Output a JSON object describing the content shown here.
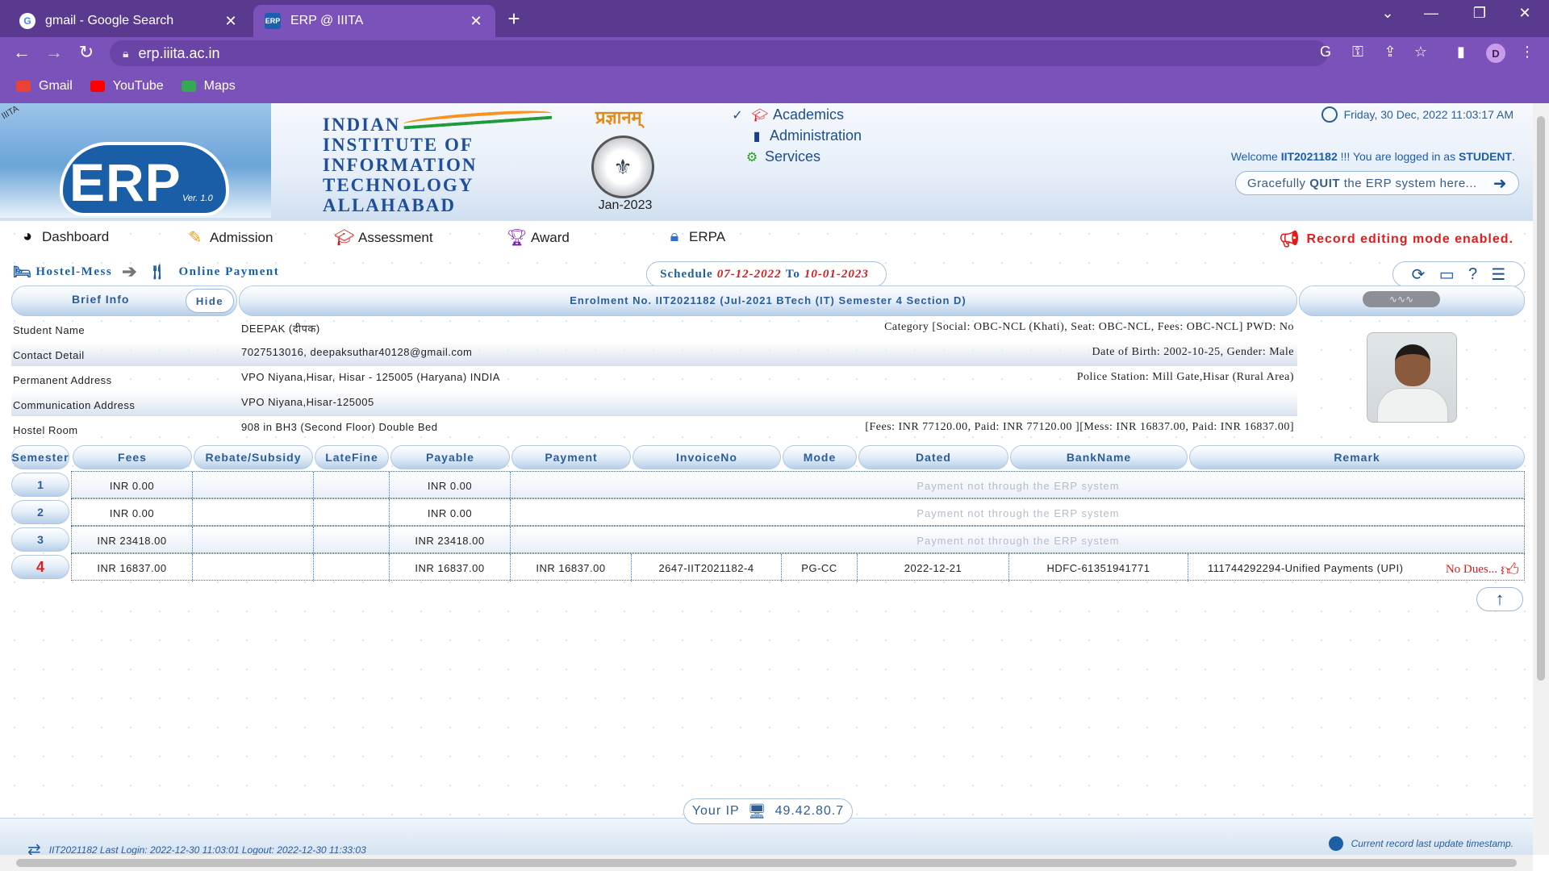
{
  "browser": {
    "tabs": [
      {
        "title": "gmail - Google Search",
        "favicon": "google-icon",
        "active": false
      },
      {
        "title": "ERP @ IIITA",
        "favicon": "erp-icon",
        "active": true
      }
    ],
    "url": "erp.iiita.ac.in",
    "bookmarks": [
      {
        "label": "Gmail",
        "icon": "gmail-icon",
        "color": "#ea4335"
      },
      {
        "label": "YouTube",
        "icon": "youtube-icon",
        "color": "#ff0000"
      },
      {
        "label": "Maps",
        "icon": "maps-icon",
        "color": "#34a853"
      }
    ],
    "profile_initial": "D"
  },
  "header": {
    "logo_text": "ERP",
    "logo_version": "Ver. 1.0",
    "corner_label": "IIITA",
    "institute_lines": [
      "INDIAN",
      "INSTITUTE OF",
      "INFORMATION",
      "TECHNOLOGY",
      "ALLAHABAD"
    ],
    "hindi_title": "प्रज्ञानम्",
    "session": "Jan-2023",
    "top_menu": [
      {
        "label": "Academics",
        "icon": "graduation-cap-icon",
        "checked": true
      },
      {
        "label": "Administration",
        "icon": "admin-icon"
      },
      {
        "label": "Services",
        "icon": "gears-icon"
      }
    ],
    "datetime": "Friday, 30 Dec, 2022 11:03:17 AM",
    "welcome_prefix": "Welcome",
    "user_id": "IIT2021182",
    "welcome_mid": "!!! You are logged in as",
    "role": "STUDENT",
    "quit_prefix": "Gracefully",
    "quit_bold": "QUIT",
    "quit_suffix": "the ERP system here...",
    "quit_icon": "sign-out-icon"
  },
  "main_menu": [
    {
      "label": "Dashboard",
      "icon": "dashboard-icon"
    },
    {
      "label": "Admission",
      "icon": "edit-icon"
    },
    {
      "label": "Assessment",
      "icon": "mortarboard-icon"
    },
    {
      "label": "Award",
      "icon": "trophy-icon"
    },
    {
      "label": "ERPA",
      "icon": "lock-icon"
    }
  ],
  "record_mode": "Record editing mode enabled.",
  "breadcrumb": {
    "parent": "Hostel-Mess",
    "current": "Online Payment"
  },
  "schedule": {
    "label": "Schedule",
    "from": "07-12-2022",
    "to_word": "To",
    "to": "10-01-2023"
  },
  "brief": {
    "label": "Brief Info",
    "hide_label": "Hide",
    "enrolment": "Enrolment No. IIT2021182 (Jul-2021 BTech (IT) Semester 4 Section D)",
    "signature_label": "signature"
  },
  "student": [
    {
      "label": "Student Name",
      "value": "DEEPAK (दीपक)",
      "right": "Category [Social: OBC-NCL (Khati), Seat: OBC-NCL, Fees: OBC-NCL] PWD: No"
    },
    {
      "label": "Contact Detail",
      "value": "7027513016, deepaksuthar40128@gmail.com",
      "right": "Date of Birth: 2002-10-25, Gender: Male"
    },
    {
      "label": "Permanent Address",
      "value": "VPO Niyana,Hisar, Hisar - 125005 (Haryana) INDIA",
      "right": "Police Station: Mill Gate,Hisar (Rural Area)"
    },
    {
      "label": "Communication Address",
      "value": "VPO Niyana,Hisar-125005",
      "right": ""
    },
    {
      "label": "Hostel Room",
      "value": "908 in BH3 (Second Floor) Double Bed",
      "right": "[Fees: INR 77120.00, Paid: INR 77120.00 ][Mess: INR 16837.00, Paid: INR 16837.00]"
    }
  ],
  "fee_table": {
    "columns": [
      "Semester",
      "Fees",
      "Rebate/Subsidy",
      "LateFine",
      "Payable",
      "Payment",
      "InvoiceNo",
      "Mode",
      "Dated",
      "BankName",
      "Remark"
    ],
    "rows": [
      {
        "semester": "1",
        "fees": "INR 0.00",
        "rebate": "",
        "latefine": "",
        "payable": "INR 0.00",
        "note": "Payment not through the ERP system"
      },
      {
        "semester": "2",
        "fees": "INR 0.00",
        "rebate": "",
        "latefine": "",
        "payable": "INR 0.00",
        "note": "Payment not through the ERP system"
      },
      {
        "semester": "3",
        "fees": "INR 23418.00",
        "rebate": "",
        "latefine": "",
        "payable": "INR 23418.00",
        "note": "Payment not through the ERP system"
      },
      {
        "semester": "4",
        "fees": "INR 16837.00",
        "rebate": "",
        "latefine": "",
        "payable": "INR 16837.00",
        "payment": "INR 16837.00",
        "invoice": "2647-IIT2021182-4",
        "mode": "PG-CC",
        "dated": "2022-12-21",
        "bank": "HDFC-61351941771",
        "remark": "111744292294-Unified Payments (UPI)",
        "status": "No Dues..."
      }
    ]
  },
  "footer": {
    "last_login": "IIT2021182 Last Login: 2022-12-30 11:03:01 Logout: 2022-12-30 11:33:03",
    "ip_label": "Your IP",
    "ip": "49.42.80.7",
    "last_update": "Current record last update timestamp."
  }
}
